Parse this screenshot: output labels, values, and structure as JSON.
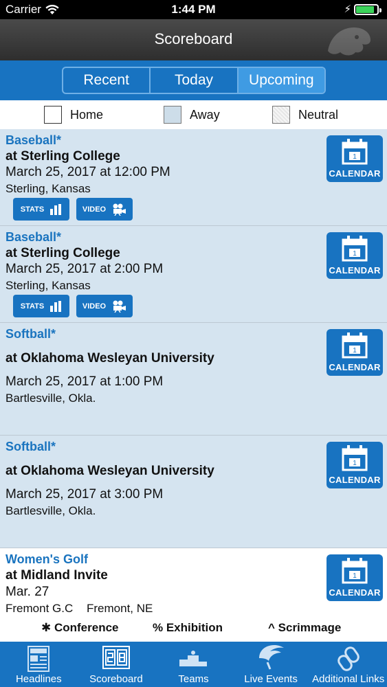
{
  "status": {
    "carrier": "Carrier",
    "time": "1:44 PM"
  },
  "header": {
    "title": "Scoreboard"
  },
  "segments": [
    {
      "label": "Recent",
      "active": false
    },
    {
      "label": "Today",
      "active": false
    },
    {
      "label": "Upcoming",
      "active": true
    }
  ],
  "filters": {
    "home": "Home",
    "away": "Away",
    "neutral": "Neutral"
  },
  "calendar_label": "CALENDAR",
  "calendar_day": "1",
  "stats_label": "STATS",
  "video_label": "VIDEO",
  "events": [
    {
      "sport": "Baseball*",
      "opponent": "at Sterling College",
      "datetime": "March 25, 2017 at 12:00 PM",
      "location": "Sterling, Kansas",
      "type": "away"
    },
    {
      "sport": "Baseball*",
      "opponent": "at Sterling College",
      "datetime": "March 25, 2017 at 2:00 PM",
      "location": "Sterling, Kansas",
      "type": "away"
    },
    {
      "sport": "Softball*",
      "opponent": "at Oklahoma Wesleyan University",
      "datetime": "March 25, 2017 at 1:00 PM",
      "location": "Bartlesville, Okla.",
      "type": "away"
    },
    {
      "sport": "Softball*",
      "opponent": "at Oklahoma Wesleyan University",
      "datetime": "March 25, 2017 at 3:00 PM",
      "location": "Bartlesville, Okla.",
      "type": "away"
    },
    {
      "sport": "Women's Golf",
      "opponent": "at Midland Invite",
      "datetime": "Mar. 27",
      "location": "Fremont G.C",
      "location_right": "Fremont, NE",
      "type": "home"
    }
  ],
  "legend": {
    "conference": "✱ Conference",
    "exhibition": "% Exhibition",
    "scrimmage": "^ Scrimmage"
  },
  "tabs": [
    {
      "label": "Headlines",
      "icon": "news-icon"
    },
    {
      "label": "Scoreboard",
      "icon": "scoreboard-icon"
    },
    {
      "label": "Teams",
      "icon": "podium-icon"
    },
    {
      "label": "Live Events",
      "icon": "live-events-icon"
    },
    {
      "label": "Additional Links",
      "icon": "links-icon"
    }
  ],
  "colors": {
    "primary_blue": "#1873c1",
    "active_segment": "#3f9be3",
    "away_row": "#d5e4f0",
    "sport_text": "#1a74bf"
  }
}
